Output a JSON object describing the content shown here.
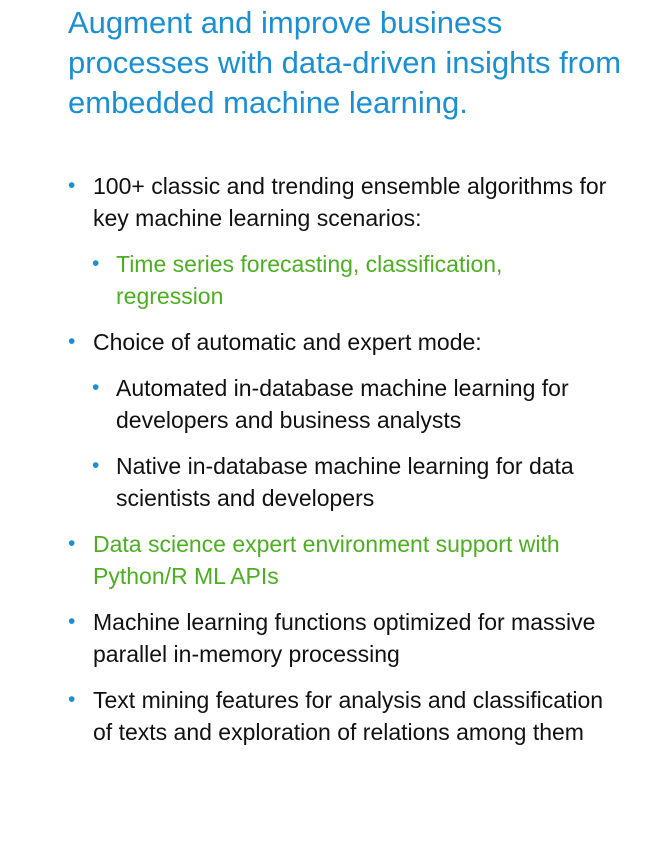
{
  "slide": {
    "title": "Augment and improve business processes with data-driven insights from embedded machine learning.",
    "bullet_glyph": "•",
    "colors": {
      "title": "#1b8fd3",
      "bullet": "#1b8fd3",
      "highlight": "#4caf22",
      "text": "#111111"
    },
    "items": [
      {
        "level": 1,
        "highlight": false,
        "text": "100+ classic and trending ensemble algorithms for key machine learning scenarios:"
      },
      {
        "level": 2,
        "highlight": true,
        "text": "Time series forecasting, classification, regression"
      },
      {
        "level": 1,
        "highlight": false,
        "text": "Choice of automatic and expert mode:"
      },
      {
        "level": 2,
        "highlight": false,
        "text": "Automated in-database machine learning for developers and business analysts"
      },
      {
        "level": 2,
        "highlight": false,
        "text": "Native in-database machine learning for data scientists and developers"
      },
      {
        "level": 1,
        "highlight": true,
        "text": "Data science expert environment support with Python/R ML APIs"
      },
      {
        "level": 1,
        "highlight": false,
        "text": "Machine learning functions optimized for massive parallel in-memory processing"
      },
      {
        "level": 1,
        "highlight": false,
        "text": "Text mining features for analysis and classification of texts and exploration of relations among them"
      }
    ]
  }
}
